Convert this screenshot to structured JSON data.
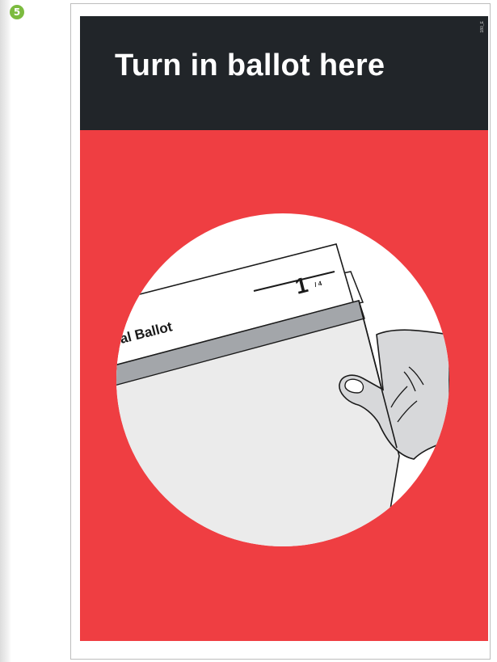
{
  "step": {
    "number": "5"
  },
  "poster": {
    "title": "Turn in ballot here",
    "code": "180_E",
    "colors": {
      "header": "#212529",
      "body": "#ef3e42",
      "circle": "#ffffff"
    }
  },
  "ballot": {
    "label": "al Ballot",
    "page_number": "1",
    "page_total": "/ 4"
  }
}
